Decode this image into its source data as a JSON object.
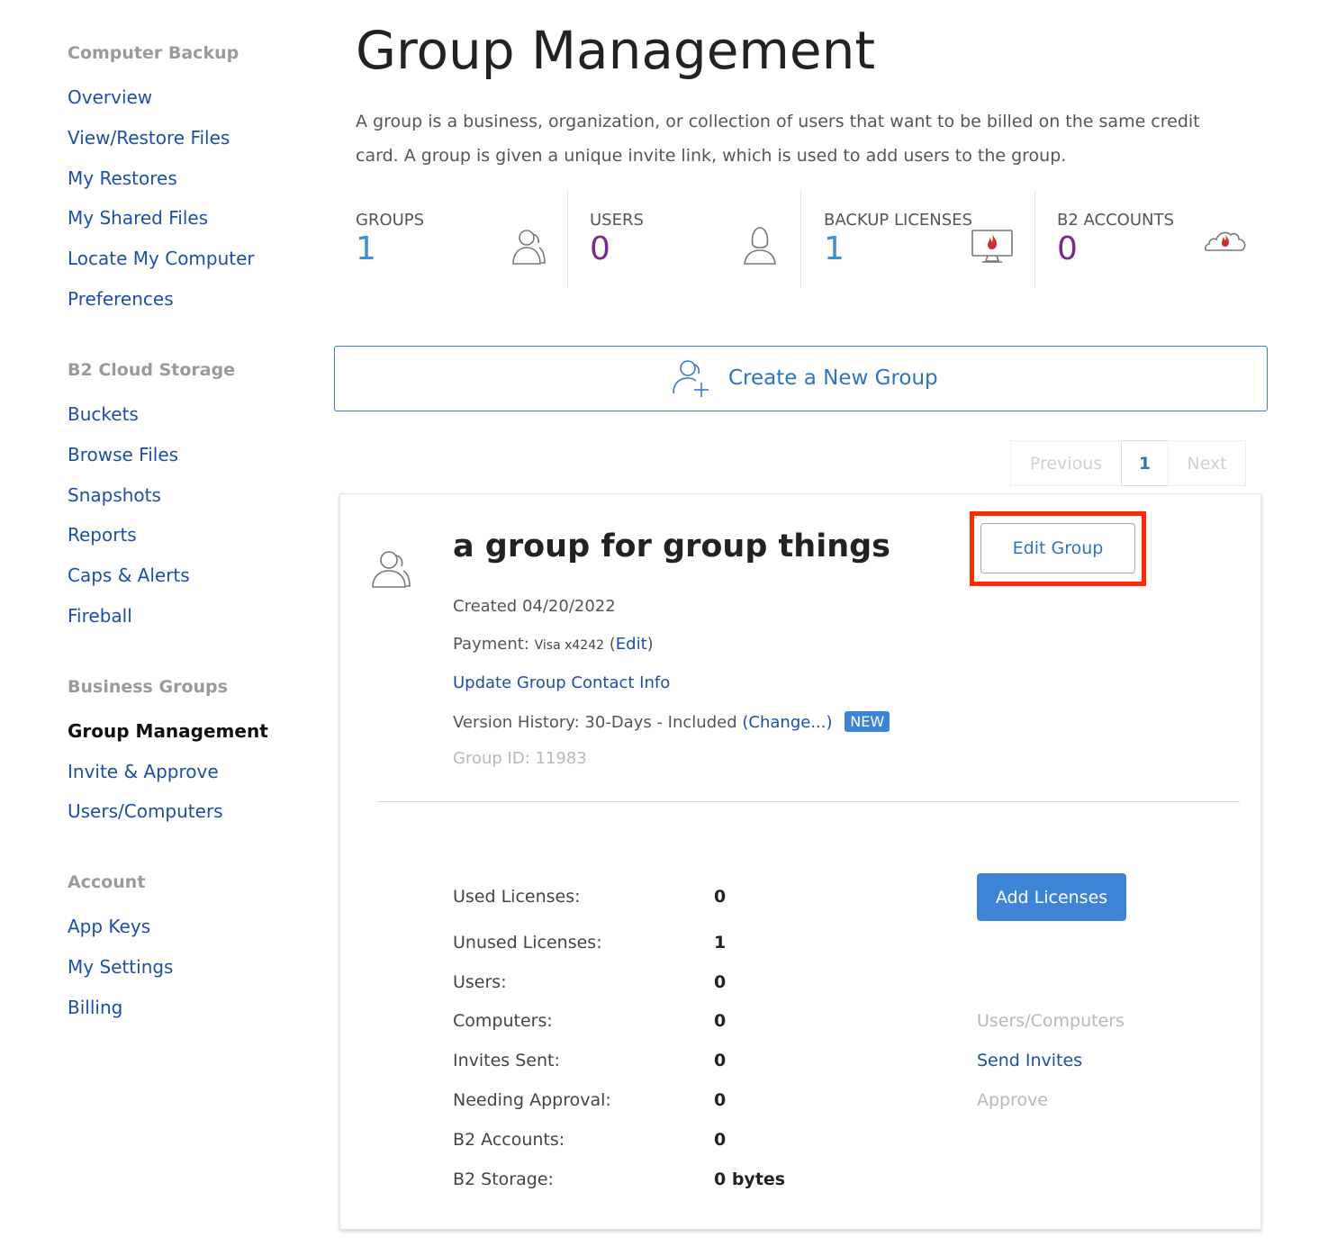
{
  "sidebar": {
    "sections": [
      {
        "heading": "Computer Backup",
        "items": [
          {
            "label": "Overview"
          },
          {
            "label": "View/Restore Files"
          },
          {
            "label": "My Restores"
          },
          {
            "label": "My Shared Files"
          },
          {
            "label": "Locate My Computer"
          },
          {
            "label": "Preferences"
          }
        ]
      },
      {
        "heading": "B2 Cloud Storage",
        "items": [
          {
            "label": "Buckets"
          },
          {
            "label": "Browse Files"
          },
          {
            "label": "Snapshots"
          },
          {
            "label": "Reports"
          },
          {
            "label": "Caps & Alerts"
          },
          {
            "label": "Fireball"
          }
        ]
      },
      {
        "heading": "Business Groups",
        "items": [
          {
            "label": "Group Management",
            "active": true
          },
          {
            "label": "Invite & Approve"
          },
          {
            "label": "Users/Computers"
          }
        ]
      },
      {
        "heading": "Account",
        "items": [
          {
            "label": "App Keys"
          },
          {
            "label": "My Settings"
          },
          {
            "label": "Billing"
          }
        ]
      }
    ]
  },
  "header": {
    "title": "Group Management",
    "description": "A group is a business, organization, or collection of users that want to be billed on the same credit card. A group is given a unique invite link, which is used to add users to the group."
  },
  "stats": [
    {
      "label": "GROUPS",
      "value": "1",
      "color": "#3d8fd6",
      "icon": "group-user-icon"
    },
    {
      "label": "USERS",
      "value": "0",
      "color": "#7a2a8a",
      "icon": "user-icon"
    },
    {
      "label": "BACKUP LICENSES",
      "value": "1",
      "color": "#3d8fd6",
      "icon": "monitor-flame-icon"
    },
    {
      "label": "B2 ACCOUNTS",
      "value": "0",
      "color": "#7a2a8a",
      "icon": "cloud-flame-icon"
    }
  ],
  "create_group": {
    "label": "Create a New Group",
    "icon": "add-user-icon"
  },
  "pagination": {
    "previous": "Previous",
    "current": "1",
    "next": "Next"
  },
  "group": {
    "name": "a group for group things",
    "edit_label": "Edit Group",
    "created": "Created 04/20/2022",
    "payment_label": "Payment:",
    "payment_card": "Visa x4242",
    "payment_edit": "Edit",
    "contact_link": "Update Group Contact Info",
    "version_history": "Version History: 30-Days - Included",
    "version_change": "(Change...)",
    "new_badge": "NEW",
    "group_id": "Group ID: 11983",
    "add_licenses": "Add Licenses",
    "rows": [
      {
        "label": "Used Licenses:",
        "value": "0"
      },
      {
        "label": "Unused Licenses:",
        "value": "1"
      },
      {
        "label": "Users:",
        "value": "0"
      },
      {
        "label": "Computers:",
        "value": "0"
      },
      {
        "label": "Invites Sent:",
        "value": "0"
      },
      {
        "label": "Needing Approval:",
        "value": "0"
      },
      {
        "label": "B2 Accounts:",
        "value": "0"
      },
      {
        "label": "B2 Storage:",
        "value": "0 bytes"
      }
    ],
    "side_links": {
      "users_computers": "Users/Computers",
      "send_invites": "Send Invites",
      "approve": "Approve"
    }
  },
  "colors": {
    "link": "#1d4fa8",
    "accent": "#3d84d6",
    "highlight": "#ff2a00",
    "purple": "#7a2a8a",
    "flame": "#d8282f"
  }
}
